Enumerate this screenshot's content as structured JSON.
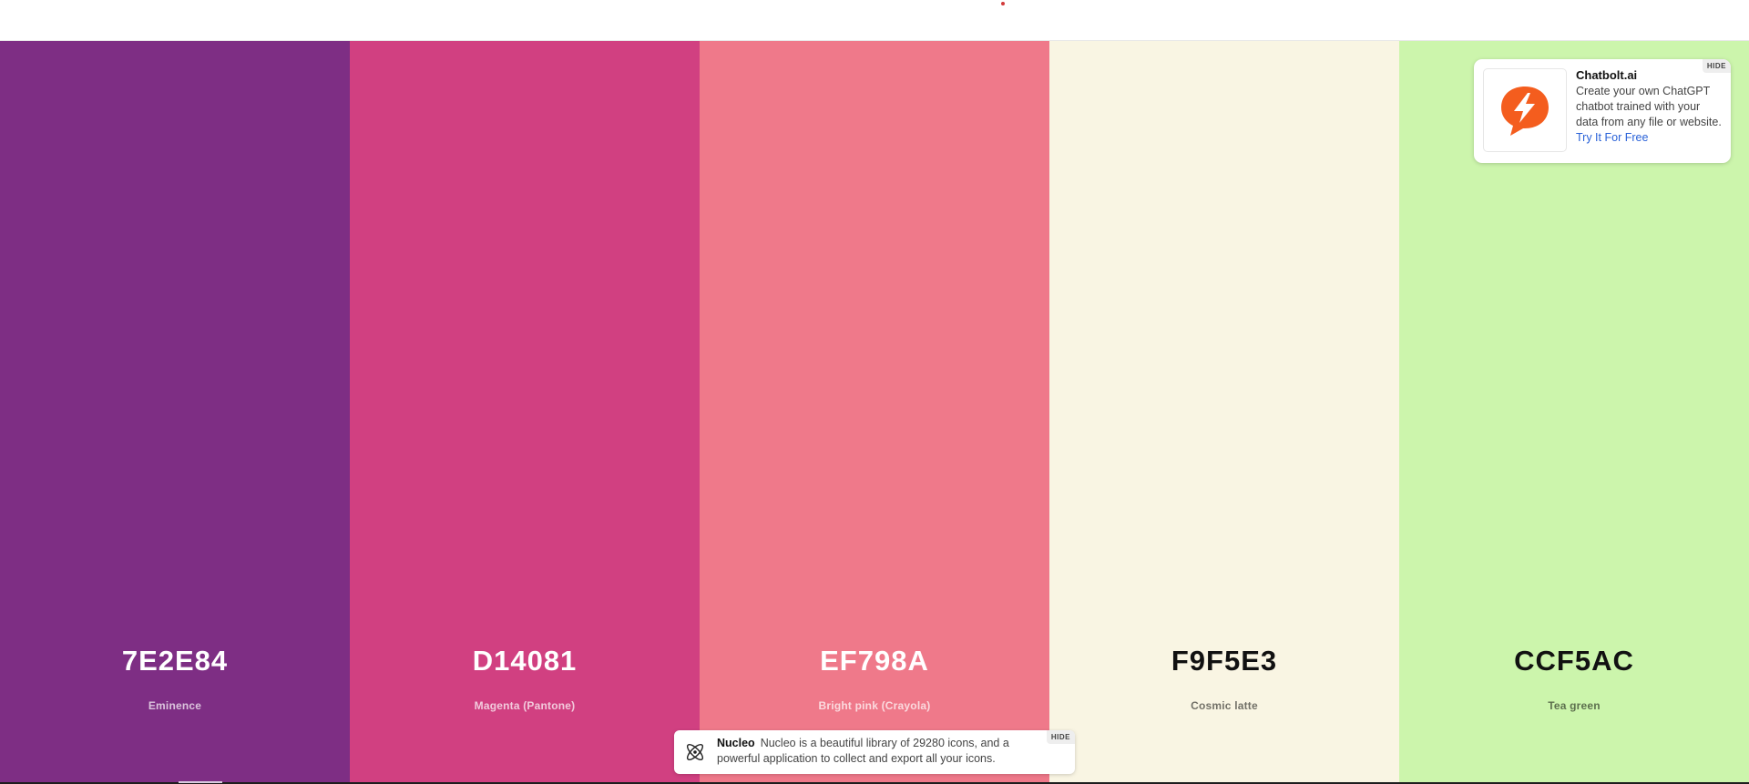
{
  "palette": [
    {
      "hex": "7E2E84",
      "name": "Eminence",
      "color": "#7E2E84",
      "tone": "dark"
    },
    {
      "hex": "D14081",
      "name": "Magenta (Pantone)",
      "color": "#D14081",
      "tone": "dark"
    },
    {
      "hex": "EF798A",
      "name": "Bright pink (Crayola)",
      "color": "#EF798A",
      "tone": "dark"
    },
    {
      "hex": "F9F5E3",
      "name": "Cosmic latte",
      "color": "#F9F5E3",
      "tone": "light"
    },
    {
      "hex": "CCF5AC",
      "name": "Tea green",
      "color": "#CCF5AC",
      "tone": "light"
    }
  ],
  "ad": {
    "brand": "Chatbolt.ai",
    "description": "Create your own ChatGPT chatbot trained with your data from any file or website.",
    "cta": "Try It For Free",
    "hide_label": "HIDE",
    "logo_icon": "lightning-chat-bubble-icon",
    "logo_color": "#F45D1E"
  },
  "nucleo": {
    "brand": "Nucleo",
    "description": "Nucleo is a beautiful library of 29280 icons, and a powerful application to collect and export all your icons.",
    "hide_label": "HIDE",
    "icon": "atom-icon"
  }
}
